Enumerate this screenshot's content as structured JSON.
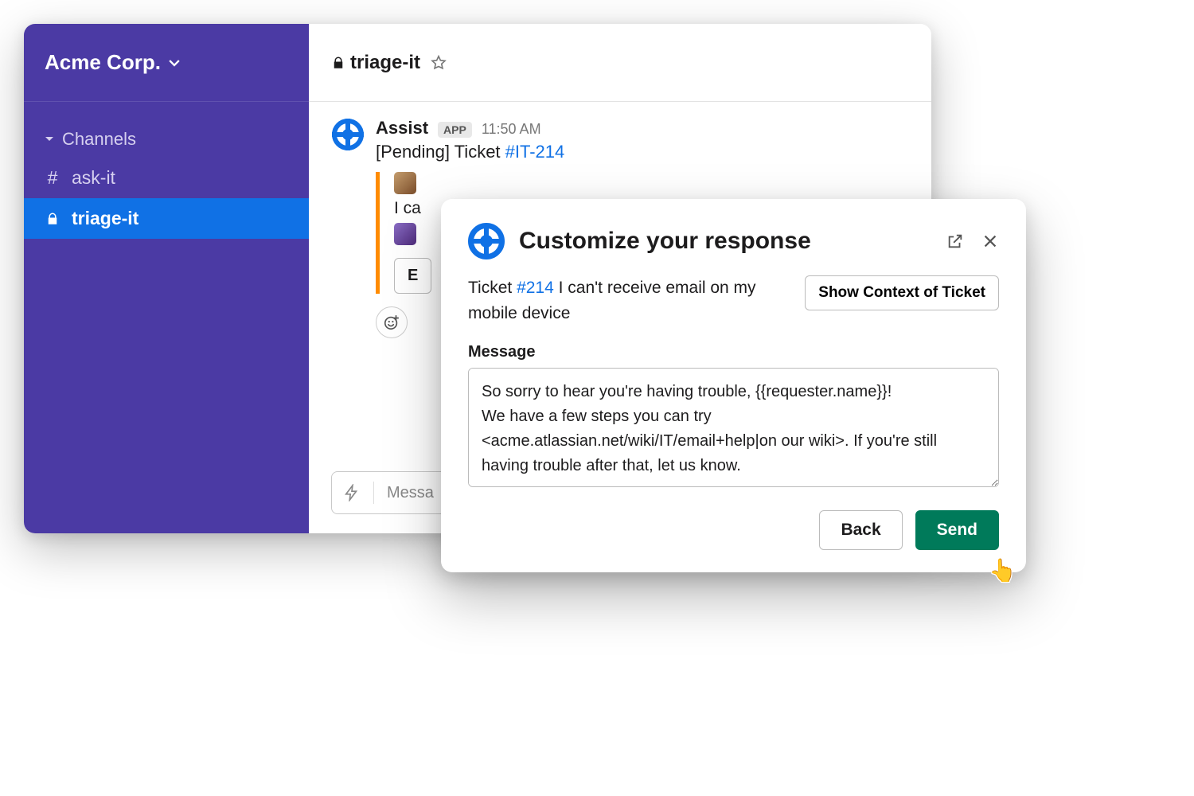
{
  "workspace": {
    "name": "Acme Corp."
  },
  "sidebar": {
    "section_label": "Channels",
    "items": [
      {
        "prefix": "#",
        "label": "ask-it",
        "active": false
      },
      {
        "prefix_icon": "lock",
        "label": "triage-it",
        "active": true
      }
    ]
  },
  "channel_header": {
    "prefix_icon": "lock",
    "name": "triage-it"
  },
  "message": {
    "author": "Assist",
    "badge": "APP",
    "time": "11:50 AM",
    "status_prefix": "[Pending] Ticket ",
    "ticket_ref": "#IT-214",
    "thread_text": "I ca",
    "ghost_button": "E"
  },
  "composer": {
    "placeholder": "Messa"
  },
  "dialog": {
    "title": "Customize your response",
    "ticket_prefix": "Ticket ",
    "ticket_ref": "#214",
    "ticket_summary_rest": " I can't receive email on my mobile device",
    "show_context": "Show Context of Ticket",
    "message_label": "Message",
    "message_value": "So sorry to hear you're having trouble, {{requester.name}}!\nWe have a few steps you can try\n<acme.atlassian.net/wiki/IT/email+help|on our wiki>. If you're still having trouble after that, let us know.",
    "back": "Back",
    "send": "Send"
  }
}
